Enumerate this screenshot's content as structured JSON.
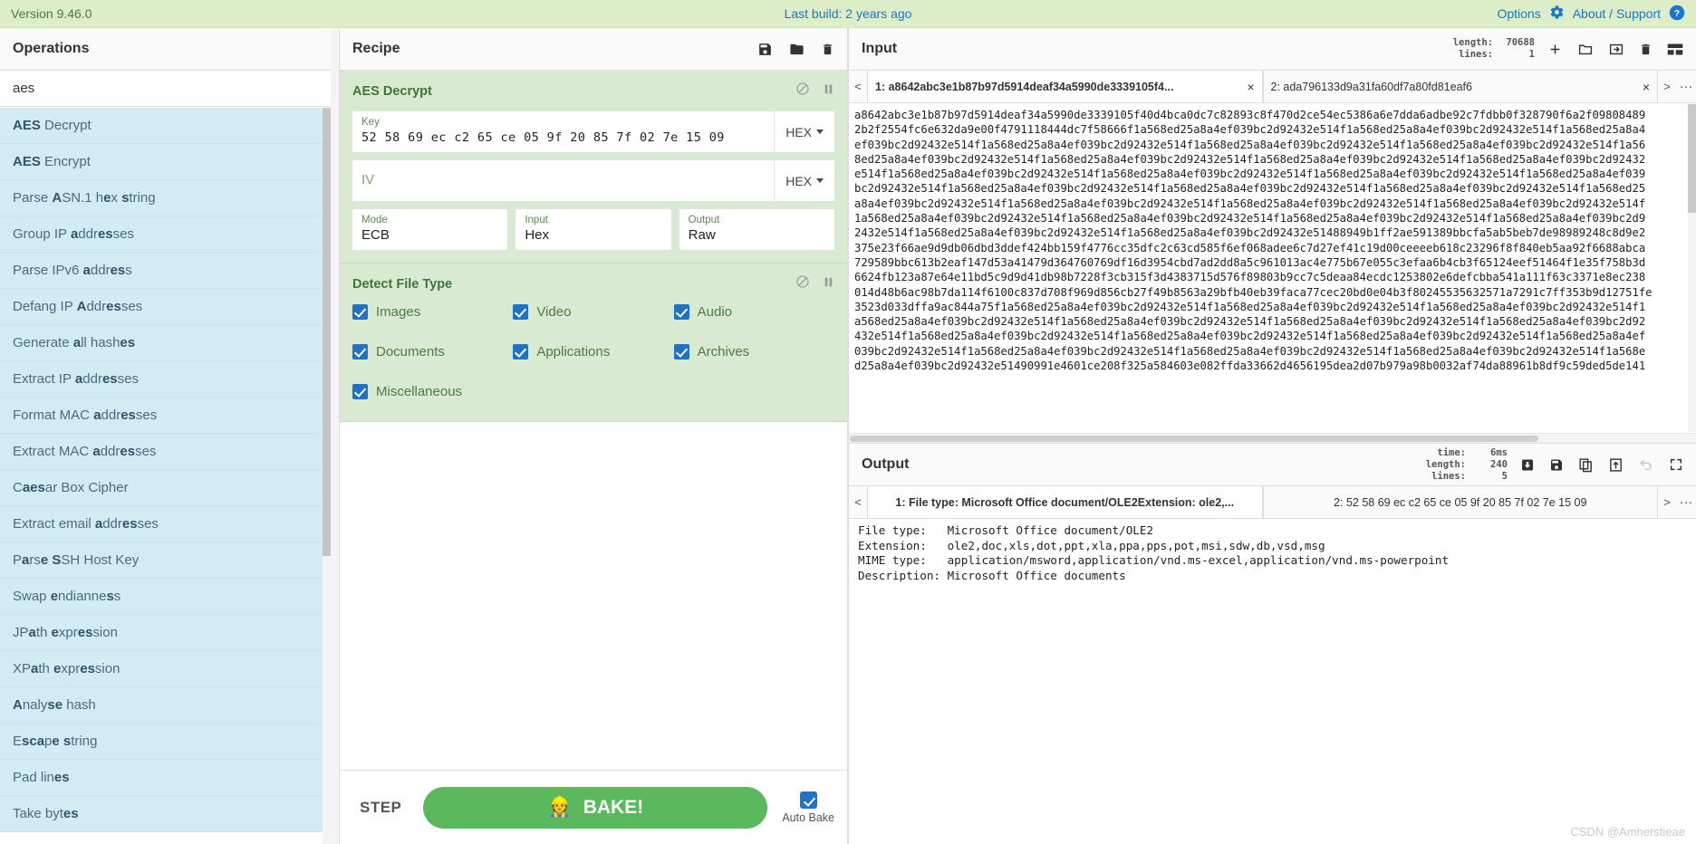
{
  "banner": {
    "version": "Version 9.46.0",
    "last_build": "Last build: 2 years ago",
    "options": "Options",
    "about": "About / Support"
  },
  "operations": {
    "title": "Operations",
    "search_value": "aes",
    "search_placeholder": "Search...",
    "items": [
      {
        "bold": "AES",
        "rest": " Decrypt",
        "pre": ""
      },
      {
        "bold": "AES",
        "rest": " Encrypt",
        "pre": ""
      },
      {
        "pre": "Parse ",
        "bold": "A",
        "rest": "SN.1 h",
        "bold2": "e",
        "rest2": "x ",
        "bold3": "s",
        "rest3": "tring",
        "label": "Parse ASN.1 hex string"
      },
      {
        "pre": "Group IP ",
        "bold": "a",
        "rest": "ddr",
        "bold2": "es",
        "rest2": "ses",
        "label": "Group IP addresses"
      },
      {
        "pre": "Parse IPv6 ",
        "bold": "a",
        "rest": "ddr",
        "bold2": "es",
        "rest2": "s",
        "label": "Parse IPv6 address"
      },
      {
        "pre": "Defang IP ",
        "bold": "A",
        "rest": "ddr",
        "bold2": "es",
        "rest2": "ses",
        "label": "Defang IP Addresses"
      },
      {
        "pre": "Generate ",
        "bold": "a",
        "rest": "ll hash",
        "bold2": "es",
        "rest2": "",
        "label": "Generate all hashes"
      },
      {
        "pre": "Extract IP ",
        "bold": "a",
        "rest": "ddr",
        "bold2": "es",
        "rest2": "ses",
        "label": "Extract IP addresses"
      },
      {
        "pre": "Format MAC ",
        "bold": "a",
        "rest": "ddr",
        "bold2": "es",
        "rest2": "ses",
        "label": "Format MAC addresses"
      },
      {
        "pre": "Extract MAC ",
        "bold": "a",
        "rest": "ddr",
        "bold2": "es",
        "rest2": "ses",
        "label": "Extract MAC addresses"
      },
      {
        "pre": "C",
        "bold": "aes",
        "rest": "ar Box Cipher",
        "label": "Caesar Box Cipher"
      },
      {
        "pre": "Extract email ",
        "bold": "a",
        "rest": "ddr",
        "bold2": "es",
        "rest2": "ses",
        "label": "Extract email addresses"
      },
      {
        "pre": "P",
        "bold": "a",
        "rest": "rs",
        "bold2": "e S",
        "rest2": "SH Host Key",
        "label": "Parse SSH Host Key"
      },
      {
        "pre": "Swap ",
        "bold": "e",
        "rest": "ndianne",
        "bold2": "s",
        "rest2": "s",
        "label": "Swap endianness"
      },
      {
        "pre": "JP",
        "bold": "a",
        "rest": "th ",
        "bold2": "e",
        "rest2": "xpr",
        "bold3": "es",
        "rest3": "sion",
        "label": "JPath expression"
      },
      {
        "pre": "XP",
        "bold": "a",
        "rest": "th ",
        "bold2": "e",
        "rest2": "xpr",
        "bold3": "es",
        "rest3": "sion",
        "label": "XPath expression"
      },
      {
        "pre": "",
        "bold": "A",
        "rest": "naly",
        "bold2": "se",
        "rest2": " hash",
        "label": "Analyse hash"
      },
      {
        "pre": "E",
        "bold": "sca",
        "rest": "p",
        "bold2": "e s",
        "rest2": "tring",
        "label": "Escape string"
      },
      {
        "pre": "Pad lin",
        "bold": "es",
        "rest": "",
        "label": "Pad lines"
      },
      {
        "pre": "Take byt",
        "bold": "es",
        "rest": "",
        "label": "Take bytes"
      }
    ]
  },
  "recipe": {
    "title": "Recipe",
    "icons": {
      "save": "save-icon",
      "load": "folder-icon",
      "clear": "trash-icon"
    },
    "ops": [
      {
        "name": "AES Decrypt",
        "disable_icon": "disable-icon",
        "breakpoint_icon": "pause-icon",
        "key": {
          "label": "Key",
          "value": "52 58 69 ec c2 65 ce 05 9f 20 85 7f 02 7e 15 09",
          "format": "HEX"
        },
        "iv": {
          "label": "IV",
          "value": "",
          "placeholder": "IV",
          "format": "HEX"
        },
        "mode": {
          "label": "Mode",
          "value": "ECB"
        },
        "input": {
          "label": "Input",
          "value": "Hex"
        },
        "output": {
          "label": "Output",
          "value": "Raw"
        }
      },
      {
        "name": "Detect File Type",
        "disable_icon": "disable-icon",
        "breakpoint_icon": "pause-icon",
        "checkboxes": [
          {
            "label": "Images",
            "checked": true
          },
          {
            "label": "Video",
            "checked": true
          },
          {
            "label": "Audio",
            "checked": true
          },
          {
            "label": "Documents",
            "checked": true
          },
          {
            "label": "Applications",
            "checked": true
          },
          {
            "label": "Archives",
            "checked": true
          },
          {
            "label": "Miscellaneous",
            "checked": true
          }
        ]
      }
    ],
    "controls": {
      "step": "STEP",
      "bake": "BAKE!",
      "bake_icon": "chef-icon",
      "auto_bake": "Auto Bake",
      "auto_bake_checked": true
    }
  },
  "input": {
    "title": "Input",
    "meta": {
      "length_label": "length:",
      "length_value": "70688",
      "lines_label": "lines:",
      "lines_value": "1"
    },
    "icons": [
      "add-tab-icon",
      "open-folder-icon",
      "open-file-icon",
      "clear-io-icon",
      "reset-layout-icon"
    ],
    "tabs": [
      {
        "num": "1",
        "label": "1: a8642abc3e1b87b97d5914deaf34a5990de3339105f4...",
        "active": true,
        "close": "×"
      },
      {
        "num": "2",
        "label": "2: ada796133d9a31fa60df7a80fd81eaf6",
        "active": false,
        "close": "×"
      }
    ],
    "tab_prev": "<",
    "tab_next": ">",
    "tab_more": "···",
    "text": "a8642abc3e1b87b97d5914deaf34a5990de3339105f40d4bca0dc7c82893c8f470d2ce54ec5386a6e7dda6adbe92c7fdbb0f328790f6a2f09808489\n2b2f2554fc6e632da9e00f4791118444dc7f58666f1a568ed25a8a4ef039bc2d92432e514f1a568ed25a8a4ef039bc2d92432e514f1a568ed25a8a4\nef039bc2d92432e514f1a568ed25a8a4ef039bc2d92432e514f1a568ed25a8a4ef039bc2d92432e514f1a568ed25a8a4ef039bc2d92432e514f1a56\n8ed25a8a4ef039bc2d92432e514f1a568ed25a8a4ef039bc2d92432e514f1a568ed25a8a4ef039bc2d92432e514f1a568ed25a8a4ef039bc2d92432\ne514f1a568ed25a8a4ef039bc2d92432e514f1a568ed25a8a4ef039bc2d92432e514f1a568ed25a8a4ef039bc2d92432e514f1a568ed25a8a4ef039\nbc2d92432e514f1a568ed25a8a4ef039bc2d92432e514f1a568ed25a8a4ef039bc2d92432e514f1a568ed25a8a4ef039bc2d92432e514f1a568ed25\na8a4ef039bc2d92432e514f1a568ed25a8a4ef039bc2d92432e514f1a568ed25a8a4ef039bc2d92432e514f1a568ed25a8a4ef039bc2d92432e514f\n1a568ed25a8a4ef039bc2d92432e514f1a568ed25a8a4ef039bc2d92432e514f1a568ed25a8a4ef039bc2d92432e514f1a568ed25a8a4ef039bc2d9\n2432e514f1a568ed25a8a4ef039bc2d92432e514f1a568ed25a8a4ef039bc2d92432e51488949b1ff2ae591389bbcfa5ab5beb7de98989248c8d9e2\n375e23f66ae9d9db06dbd3ddef424bb159f4776cc35dfc2c63cd585f6ef068adee6c7d27ef41c19d00ceeeeb618c23296f8f840eb5aa92f6688abca\n729589bbc613b2eaf147d53a41479d364760769df16d3954cbd7ad2dd8a5c961013ac4e775b67e055c3efaa6b4cb3f65124eef51464f1e35f758b3d\n6624fb123a87e64e11bd5c9d9d41db98b7228f3cb315f3d4383715d576f89803b9cc7c5deaa84ecdc1253802e6defcbba541a111f63c3371e8ec238\n014d48b6ac98b7da114f6100c837d708f969d856cb27f49b8563a29bfb40eb39faca77cec20bd0e04b3f80245535632571a7291c7ff353b9d12751fe\n3523d033dffa9ac844a75f1a568ed25a8a4ef039bc2d92432e514f1a568ed25a8a4ef039bc2d92432e514f1a568ed25a8a4ef039bc2d92432e514f1\na568ed25a8a4ef039bc2d92432e514f1a568ed25a8a4ef039bc2d92432e514f1a568ed25a8a4ef039bc2d92432e514f1a568ed25a8a4ef039bc2d92\n432e514f1a568ed25a8a4ef039bc2d92432e514f1a568ed25a8a4ef039bc2d92432e514f1a568ed25a8a4ef039bc2d92432e514f1a568ed25a8a4ef\n039bc2d92432e514f1a568ed25a8a4ef039bc2d92432e514f1a568ed25a8a4ef039bc2d92432e514f1a568ed25a8a4ef039bc2d92432e514f1a568e\nd25a8a4ef039bc2d92432e51490991e4601ce208f325a584603e082ffda33662d4656195dea2d07b979a98b0032af74da88961b8df9c59ded5de141"
  },
  "output": {
    "title": "Output",
    "meta": {
      "time_label": "time:",
      "time_value": "6ms",
      "length_label": "length:",
      "length_value": "240",
      "lines_label": "lines:",
      "lines_value": "5"
    },
    "icons": [
      "save-to-file-icon",
      "save-icon",
      "copy-icon",
      "replace-input-icon",
      "undo-icon",
      "maximise-icon"
    ],
    "tabs": [
      {
        "label": "1: File type: Microsoft Office document/OLE2Extension: ole2,...",
        "active": true
      },
      {
        "label": "2: 52 58 69 ec c2 65 ce 05 9f 20 85 7f 02 7e 15 09",
        "active": false
      }
    ],
    "tab_prev": "<",
    "tab_next": ">",
    "tab_more": "···",
    "text": "File type:   Microsoft Office document/OLE2\nExtension:   ole2,doc,xls,dot,ppt,xla,ppa,pps,pot,msi,sdw,db,vsd,msg\nMIME type:   application/msword,application/vnd.ms-excel,application/vnd.ms-powerpoint\nDescription: Microsoft Office documents"
  },
  "watermark": "CSDN @Amherstieae",
  "colors": {
    "banner_bg": "#dcedc8",
    "recipe_op_bg": "#d9ead3",
    "op_item_bg": "#d3ebf5",
    "link": "#1976d2",
    "bake_green": "#5cb85c",
    "checkbox_blue": "#1f72c4"
  }
}
